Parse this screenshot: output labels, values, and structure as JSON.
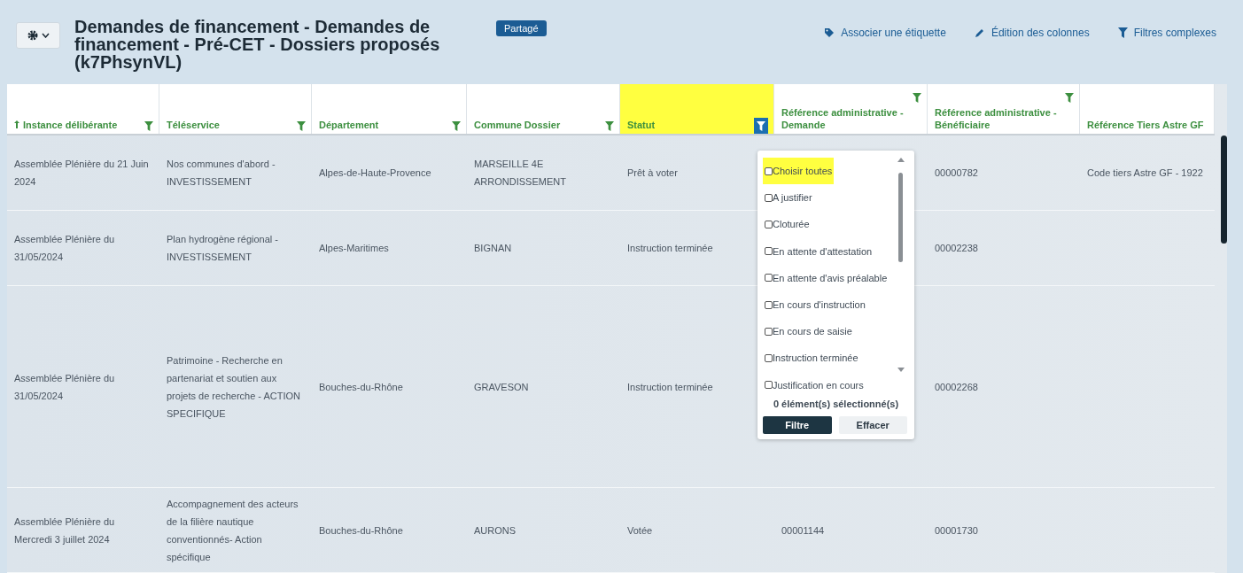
{
  "header": {
    "menu_button": {
      "expanded": false
    },
    "title": "Demandes de financement - Demandes de financement - Pré-CET - Dossiers proposés (k7PhsynVL)",
    "badge": "Partagé",
    "actions": [
      {
        "kind": "tag",
        "label": "Associer une étiquette"
      },
      {
        "kind": "edit",
        "label": "Édition des colonnes"
      },
      {
        "kind": "filter",
        "label": "Filtres complexes"
      }
    ]
  },
  "table": {
    "columns": [
      {
        "label": "Instance délibérante",
        "sorted_ascending": true,
        "filterable": true,
        "filter_active": false,
        "highlighted": false
      },
      {
        "label": "Téléservice",
        "sorted_ascending": false,
        "filterable": true,
        "filter_active": false,
        "highlighted": false
      },
      {
        "label": "Département",
        "sorted_ascending": false,
        "filterable": true,
        "filter_active": false,
        "highlighted": false
      },
      {
        "label": "Commune Dossier",
        "sorted_ascending": false,
        "filterable": true,
        "filter_active": false,
        "highlighted": false
      },
      {
        "label": "Statut",
        "sorted_ascending": false,
        "filterable": true,
        "filter_active": true,
        "highlighted": true
      },
      {
        "label": "Référence administrative - Demande",
        "sorted_ascending": false,
        "filterable": true,
        "filter_active": false,
        "highlighted": false
      },
      {
        "label": "Référence administrative - Bénéficiaire",
        "sorted_ascending": false,
        "filterable": true,
        "filter_active": false,
        "highlighted": false
      },
      {
        "label": "Référence Tiers Astre GF",
        "sorted_ascending": false,
        "filterable": false,
        "highlighted": false
      }
    ],
    "rows": [
      {
        "cells": [
          "Assemblée Plénière du 21 Juin 2024",
          "Nos communes d'abord - INVESTISSEMENT",
          "Alpes-de-Haute-Provence",
          "MARSEILLE 4E ARRONDISSEMENT",
          "Prêt à voter",
          "",
          "00000782",
          "Code tiers Astre GF - 1922"
        ]
      },
      {
        "cells": [
          "Assemblée Plénière du 31/05/2024",
          "Plan hydrogène régional - INVESTISSEMENT",
          "Alpes-Maritimes",
          "BIGNAN",
          "Instruction terminée",
          "",
          "00002238",
          ""
        ]
      },
      {
        "cells": [
          "Assemblée Plénière du 31/05/2024",
          "Patrimoine - Recherche en partenariat et soutien aux projets de recherche - ACTION SPECIFIQUE",
          "Bouches-du-Rhône",
          "GRAVESON",
          "Instruction terminée",
          "",
          "00002268",
          ""
        ]
      },
      {
        "cells": [
          "Assemblée Plénière du Mercredi 3 juillet 2024",
          "Accompagnement des acteurs de la filière nautique conventionnés- Action spécifique",
          "Bouches-du-Rhône",
          "AURONS",
          "Votée",
          "00001144",
          "00001730",
          ""
        ]
      }
    ]
  },
  "filter_dropdown": {
    "options": [
      {
        "label": "Choisir toutes",
        "checked": false,
        "highlighted": true
      },
      {
        "label": "A justifier",
        "checked": false,
        "highlighted": false
      },
      {
        "label": "Cloturée",
        "checked": false,
        "highlighted": false
      },
      {
        "label": "En attente d'attestation",
        "checked": false,
        "highlighted": false
      },
      {
        "label": "En attente d'avis préalable",
        "checked": false,
        "highlighted": false
      },
      {
        "label": "En cours d'instruction",
        "checked": false,
        "highlighted": false
      },
      {
        "label": "En cours de saisie",
        "checked": false,
        "highlighted": false
      },
      {
        "label": "Instruction terminée",
        "checked": false,
        "highlighted": false
      },
      {
        "label": "Justification en cours",
        "checked": false,
        "highlighted": false
      }
    ],
    "count": "0 élément(s) sélectionné(s)",
    "apply": "Filtre",
    "clear": "Effacer"
  }
}
